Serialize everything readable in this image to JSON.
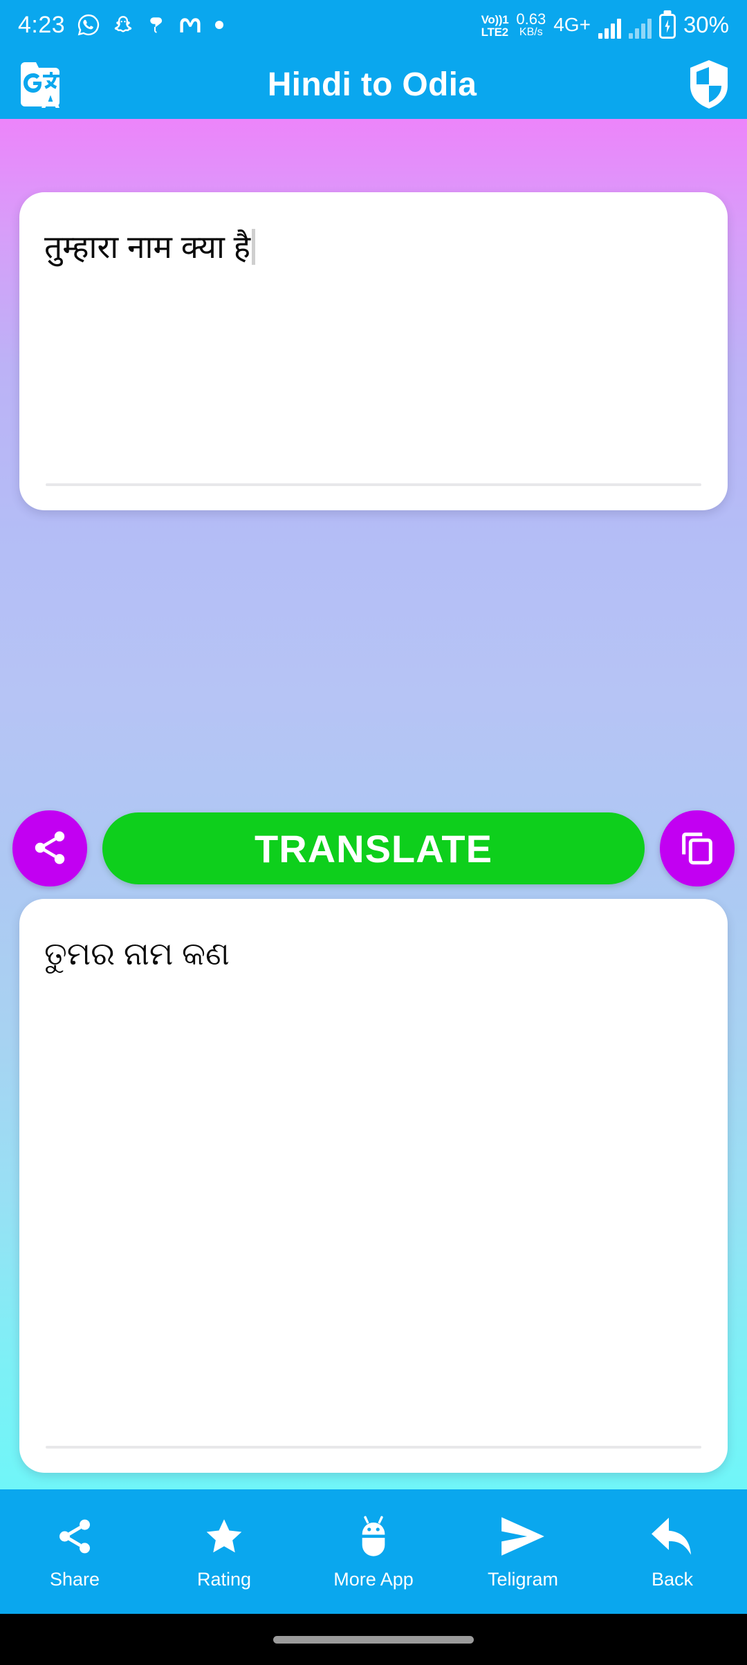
{
  "status_bar": {
    "time": "4:23",
    "left_icons": [
      "whatsapp-icon",
      "snapchat-icon",
      "bird-icon",
      "m-app-icon",
      "dot-icon"
    ],
    "volte_line1": "Vo))1",
    "volte_line2": "LTE2",
    "net_speed_value": "0.63",
    "net_speed_unit": "KB/s",
    "network_type": "4G+",
    "battery_percent": "30%",
    "background_color": "#0aa7ee"
  },
  "app_bar": {
    "title": "Hindi to Odia",
    "logo_icon": "google-translate-logo",
    "shield_icon": "shield-icon",
    "background_color": "#0aa7ee"
  },
  "input_card": {
    "text": "तुम्हारा नाम क्या है",
    "has_caret": true
  },
  "actions": {
    "share_icon": "share-icon",
    "translate_label": "TRANSLATE",
    "copy_icon": "copy-icon",
    "translate_color": "#0ecf1c",
    "round_button_color": "#c200f2"
  },
  "output_card": {
    "text": "ତୁମର ନାମ କଣ"
  },
  "bottom_nav": {
    "items": [
      {
        "label": "Share",
        "icon": "share-icon"
      },
      {
        "label": "Rating",
        "icon": "star-icon"
      },
      {
        "label": "More App",
        "icon": "android-robot-icon"
      },
      {
        "label": "Teligram",
        "icon": "telegram-send-icon"
      },
      {
        "label": "Back",
        "icon": "back-arrow-icon"
      }
    ],
    "background_color": "#0aa7ee"
  }
}
